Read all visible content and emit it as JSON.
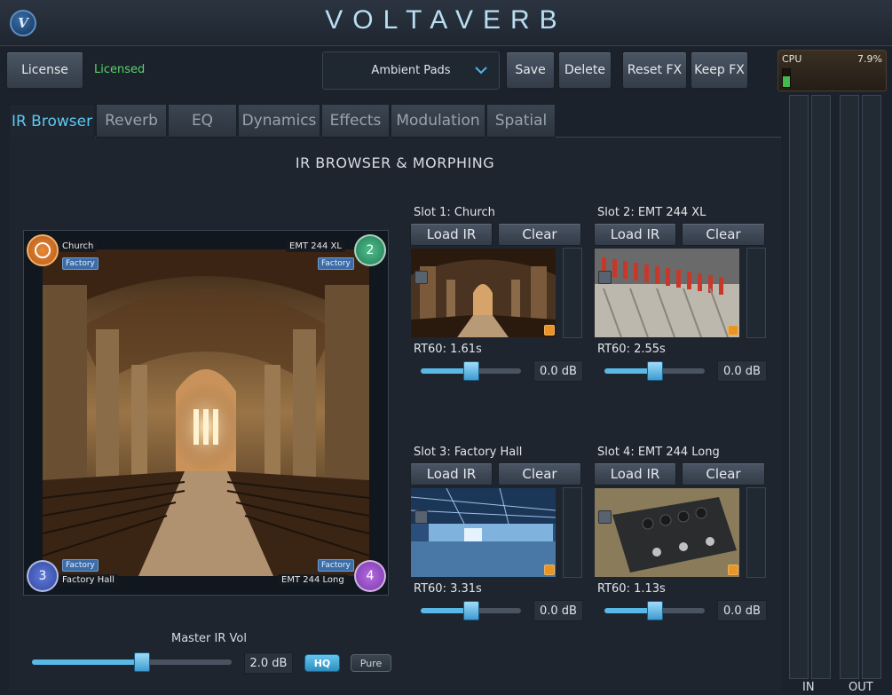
{
  "app": {
    "title": "VOLTAVERB",
    "logo_text": "V"
  },
  "toolbar": {
    "license_label": "License",
    "license_status": "Licensed",
    "preset_value": "Ambient Pads",
    "save_label": "Save",
    "delete_label": "Delete",
    "reset_fx_label": "Reset FX",
    "keep_fx_label": "Keep FX"
  },
  "cpu": {
    "label": "CPU",
    "value_text": "7.9%",
    "value": 0.079
  },
  "meters": {
    "in_label": "IN",
    "out_label": "OUT"
  },
  "tabs": [
    {
      "label": "IR Browser",
      "active": true
    },
    {
      "label": "Reverb",
      "active": false
    },
    {
      "label": "EQ",
      "active": false
    },
    {
      "label": "Dynamics",
      "active": false
    },
    {
      "label": "Effects",
      "active": false
    },
    {
      "label": "Modulation",
      "active": false
    },
    {
      "label": "Spatial",
      "active": false
    }
  ],
  "section_title": "IR BROWSER & MORPHING",
  "morph": {
    "corners": [
      {
        "number": "1",
        "name": "Church",
        "badge": "Factory"
      },
      {
        "number": "2",
        "name": "EMT 244 XL",
        "badge": "Factory"
      },
      {
        "number": "3",
        "name": "Factory Hall",
        "badge": "Factory"
      },
      {
        "number": "4",
        "name": "EMT 244 Long",
        "badge": "Factory"
      }
    ]
  },
  "master": {
    "label": "Master IR Vol",
    "value_text": "2.0 dB",
    "level": 0.55,
    "hq_label": "HQ",
    "pure_label": "Pure"
  },
  "slots": [
    {
      "title": "Slot 1: Church",
      "load_label": "Load IR",
      "clear_label": "Clear",
      "rt60": "RT60: 1.61s",
      "gain": "0.0 dB",
      "level": 0.5
    },
    {
      "title": "Slot 2: EMT 244 XL",
      "load_label": "Load IR",
      "clear_label": "Clear",
      "rt60": "RT60: 2.55s",
      "gain": "0.0 dB",
      "level": 0.5
    },
    {
      "title": "Slot 3: Factory Hall",
      "load_label": "Load IR",
      "clear_label": "Clear",
      "rt60": "RT60: 3.31s",
      "gain": "0.0 dB",
      "level": 0.5
    },
    {
      "title": "Slot 4: EMT 244 Long",
      "load_label": "Load IR",
      "clear_label": "Clear",
      "rt60": "RT60: 1.13s",
      "gain": "0.0 dB",
      "level": 0.5
    }
  ],
  "colors": {
    "accent": "#58b8e6",
    "licensed": "#58d36d",
    "corner_1": "#e58a3a",
    "corner_2": "#4fbf8c",
    "corner_3": "#5d7ad9",
    "corner_4": "#b46ce0"
  }
}
